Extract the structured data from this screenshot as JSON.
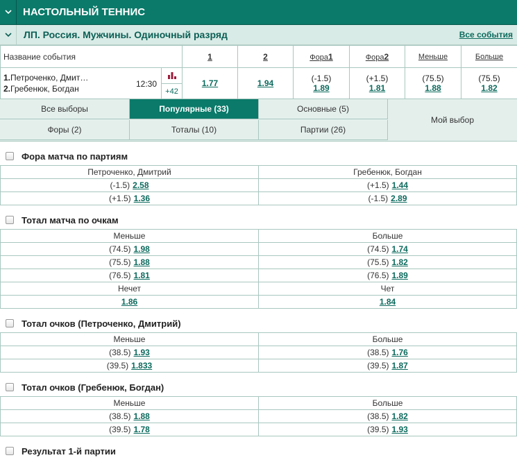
{
  "sport_header": {
    "title": "НАСТОЛЬНЫЙ ТЕННИС"
  },
  "league_header": {
    "title": "ЛП. Россия. Мужчины. Одиночный разряд",
    "all_events": "Все события"
  },
  "event_table": {
    "headers": {
      "name": "Название события",
      "c1": "1",
      "c2": "2",
      "fora1": "Фора",
      "fora1_n": "1",
      "fora2": "Фора",
      "fora2_n": "2",
      "less": "Меньше",
      "more": "Больше"
    },
    "player1": "Петроченко, Дмит…",
    "player1_n": "1.",
    "player2": "Гребенюк, Богдан",
    "player2_n": "2.",
    "time": "12:30",
    "more_count": "+42",
    "odd1": "1.77",
    "odd2": "1.94",
    "fora1_line": "(-1.5)",
    "fora1_odd": "1.89",
    "fora2_line": "(+1.5)",
    "fora2_odd": "1.81",
    "less_line": "(75.5)",
    "less_odd": "1.88",
    "more_line": "(75.5)",
    "more_odd": "1.82"
  },
  "tabs": {
    "all": "Все выборы",
    "popular": "Популярные (33)",
    "main": "Основные (5)",
    "fora": "Форы (2)",
    "totals": "Тоталы (10)",
    "sets": "Партии (26)",
    "mine": "Мой выбор"
  },
  "sections": {
    "s1": {
      "title": "Фора матча по партиям",
      "left_head": "Петроченко, Дмитрий",
      "right_head": "Гребенюк, Богдан",
      "rows": [
        {
          "l_line": "(-1.5)",
          "l_odd": "2.58",
          "r_line": "(+1.5)",
          "r_odd": "1.44"
        },
        {
          "l_line": "(+1.5)",
          "l_odd": "1.36",
          "r_line": "(-1.5)",
          "r_odd": "2.89"
        }
      ]
    },
    "s2": {
      "title": "Тотал матча по очкам",
      "left_head": "Меньше",
      "right_head": "Больше",
      "rows": [
        {
          "l_line": "(74.5)",
          "l_odd": "1.98",
          "r_line": "(74.5)",
          "r_odd": "1.74"
        },
        {
          "l_line": "(75.5)",
          "l_odd": "1.88",
          "r_line": "(75.5)",
          "r_odd": "1.82"
        },
        {
          "l_line": "(76.5)",
          "l_odd": "1.81",
          "r_line": "(76.5)",
          "r_odd": "1.89"
        }
      ],
      "odd_head": "Нечет",
      "even_head": "Чет",
      "odd_val": "1.86",
      "even_val": "1.84"
    },
    "s3": {
      "title": "Тотал очков (Петроченко, Дмитрий)",
      "left_head": "Меньше",
      "right_head": "Больше",
      "rows": [
        {
          "l_line": "(38.5)",
          "l_odd": "1.93",
          "r_line": "(38.5)",
          "r_odd": "1.76"
        },
        {
          "l_line": "(39.5)",
          "l_odd": "1.833",
          "r_line": "(39.5)",
          "r_odd": "1.87"
        }
      ]
    },
    "s4": {
      "title": "Тотал очков (Гребенюк, Богдан)",
      "left_head": "Меньше",
      "right_head": "Больше",
      "rows": [
        {
          "l_line": "(38.5)",
          "l_odd": "1.88",
          "r_line": "(38.5)",
          "r_odd": "1.82"
        },
        {
          "l_line": "(39.5)",
          "l_odd": "1.78",
          "r_line": "(39.5)",
          "r_odd": "1.93"
        }
      ]
    },
    "s5": {
      "title": "Результат 1-й партии"
    }
  },
  "colors": {
    "brand": "#0b7a6a",
    "link": "#0b6a5d",
    "stats_icon": "#9c1b3a"
  }
}
